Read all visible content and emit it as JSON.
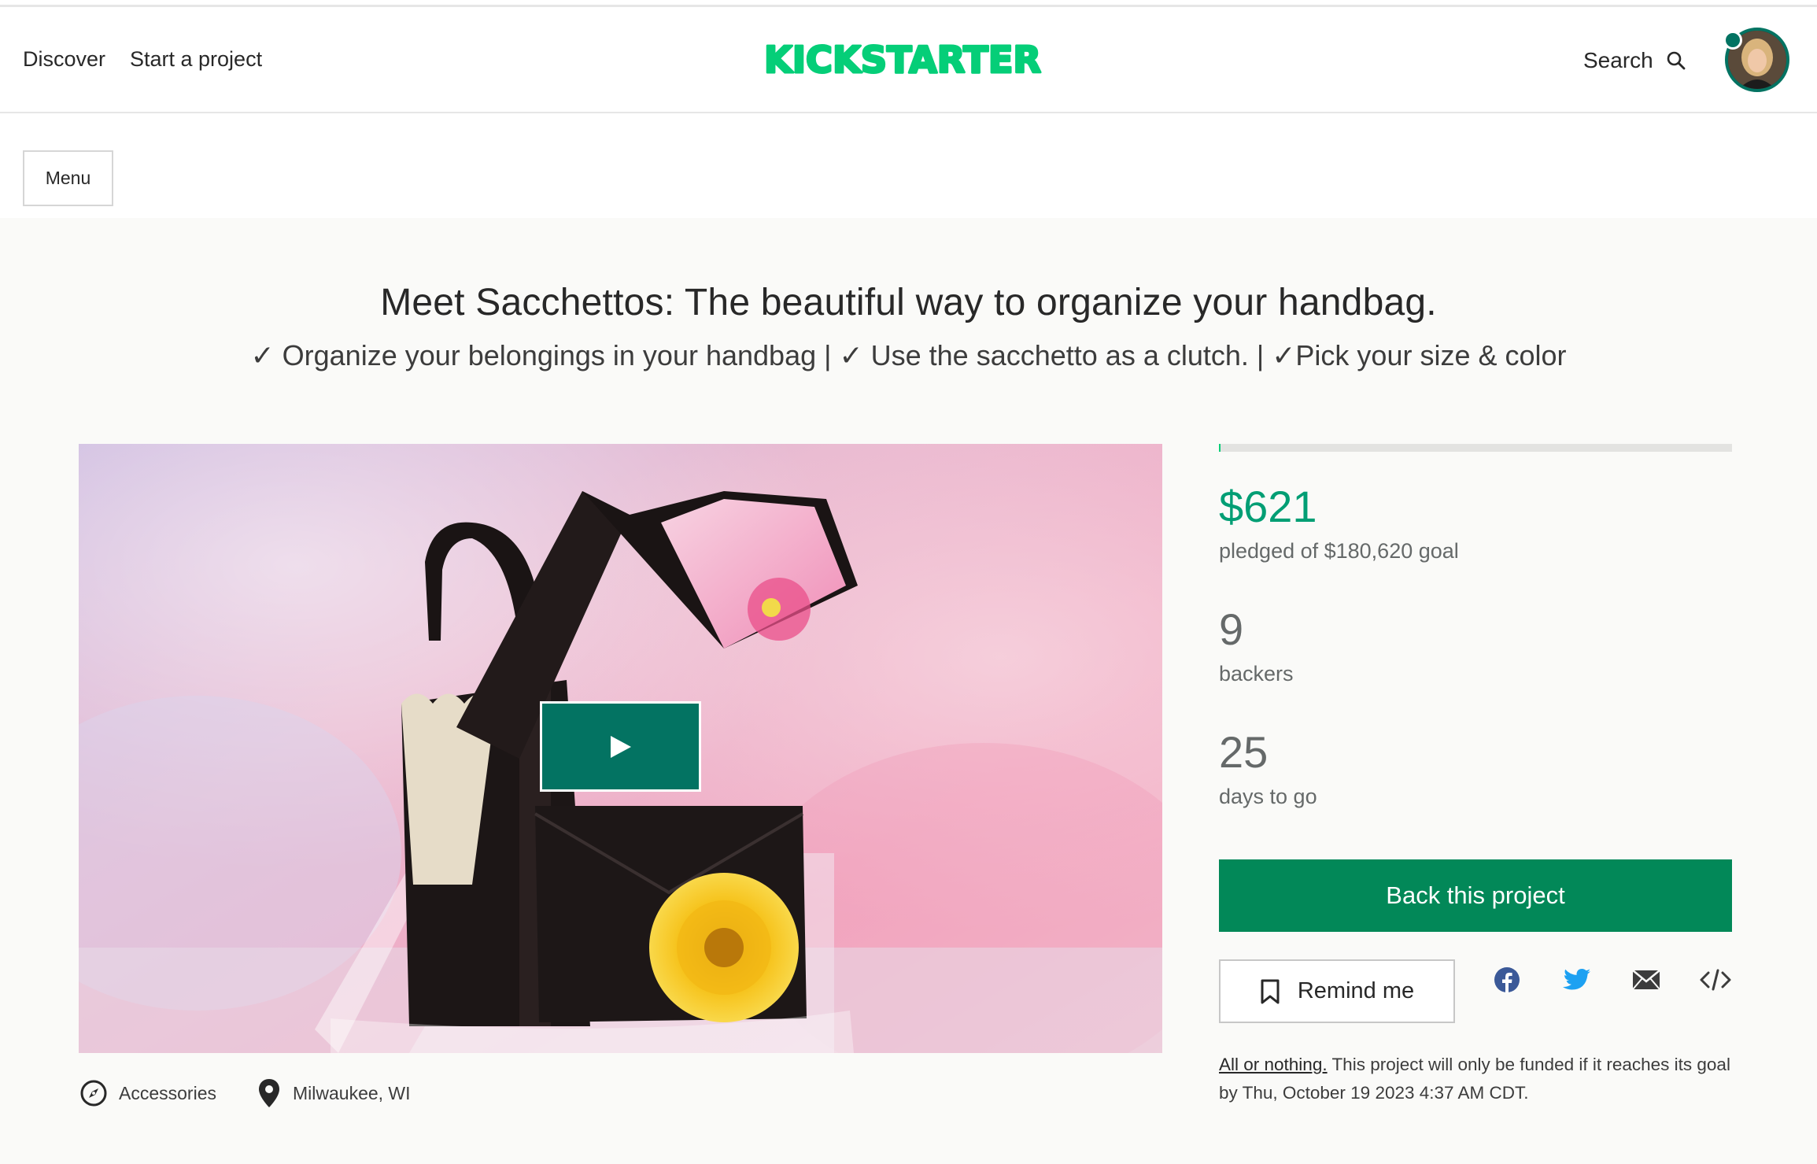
{
  "nav": {
    "discover": "Discover",
    "start_project": "Start a project",
    "logo_text": "KICKSTARTER",
    "search": "Search"
  },
  "menu": {
    "label": "Menu"
  },
  "project": {
    "title": "Meet Sacchettos: The beautiful way to organize your handbag.",
    "subtitle": "✓ Organize your belongings in your handbag | ✓ Use the sacchetto as a clutch. | ✓Pick your size & color",
    "category": "Accessories",
    "location": "Milwaukee, WI"
  },
  "stats": {
    "pledged": "$621",
    "goal_text": "pledged of $180,620 goal",
    "funded_fraction": 0.0034,
    "backers": "9",
    "backers_label": "backers",
    "days": "25",
    "days_label": "days to go"
  },
  "actions": {
    "back": "Back this project",
    "remind": "Remind me"
  },
  "funding_note": {
    "link": "All or nothing.",
    "text": " This project will only be funded if it reaches its goal by Thu, October 19 2023 4:37 AM CDT."
  },
  "colors": {
    "brand_green": "#05ce78",
    "action_green": "#028858",
    "pledged_green": "#009e74",
    "play_green": "#037362",
    "facebook_blue": "#3b5998",
    "twitter_blue": "#1da1f2"
  },
  "icons": {
    "search": "search-icon",
    "play": "play-icon",
    "category": "compass-icon",
    "location": "location-pin-icon",
    "remind": "bookmark-icon",
    "facebook": "facebook-icon",
    "twitter": "twitter-icon",
    "email": "email-icon",
    "embed": "embed-icon"
  }
}
